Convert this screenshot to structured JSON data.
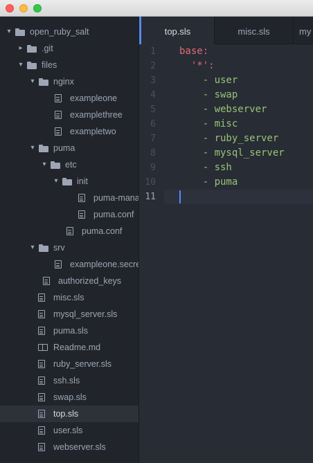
{
  "window": {
    "traffic_lights": [
      "close",
      "minimize",
      "maximize"
    ]
  },
  "sidebar": {
    "items": [
      {
        "label": "open_ruby_salt",
        "type": "folder",
        "expanded": true,
        "depth": 0
      },
      {
        "label": ".git",
        "type": "folder",
        "expanded": false,
        "depth": 1
      },
      {
        "label": "files",
        "type": "folder",
        "expanded": true,
        "depth": 1
      },
      {
        "label": "nginx",
        "type": "folder",
        "expanded": true,
        "depth": 2
      },
      {
        "label": "exampleone",
        "type": "file",
        "depth": 3
      },
      {
        "label": "examplethree",
        "type": "file",
        "depth": 3
      },
      {
        "label": "exampletwo",
        "type": "file",
        "depth": 3
      },
      {
        "label": "puma",
        "type": "folder",
        "expanded": true,
        "depth": 2
      },
      {
        "label": "etc",
        "type": "folder",
        "expanded": true,
        "depth": 3
      },
      {
        "label": "init",
        "type": "folder",
        "expanded": true,
        "depth": 4
      },
      {
        "label": "puma-manag",
        "type": "file",
        "depth": 5
      },
      {
        "label": "puma.conf",
        "type": "file",
        "depth": 5
      },
      {
        "label": "puma.conf",
        "type": "file",
        "depth": 4
      },
      {
        "label": "srv",
        "type": "folder",
        "expanded": true,
        "depth": 2
      },
      {
        "label": "exampleone.secret",
        "type": "file",
        "depth": 3
      },
      {
        "label": "authorized_keys",
        "type": "file",
        "depth": 2
      },
      {
        "label": "misc.sls",
        "type": "file",
        "depth": 1
      },
      {
        "label": "mysql_server.sls",
        "type": "file",
        "depth": 1
      },
      {
        "label": "puma.sls",
        "type": "file",
        "depth": 1
      },
      {
        "label": "Readme.md",
        "type": "book",
        "depth": 1
      },
      {
        "label": "ruby_server.sls",
        "type": "file",
        "depth": 1
      },
      {
        "label": "ssh.sls",
        "type": "file",
        "depth": 1
      },
      {
        "label": "swap.sls",
        "type": "file",
        "depth": 1
      },
      {
        "label": "top.sls",
        "type": "file",
        "depth": 1,
        "selected": true
      },
      {
        "label": "user.sls",
        "type": "file",
        "depth": 1
      },
      {
        "label": "webserver.sls",
        "type": "file",
        "depth": 1
      }
    ]
  },
  "tabs": [
    {
      "label": "top.sls",
      "active": true
    },
    {
      "label": "misc.sls",
      "active": false
    },
    {
      "label": "my",
      "active": false
    }
  ],
  "editor": {
    "line_numbers": [
      "1",
      "2",
      "3",
      "4",
      "5",
      "6",
      "7",
      "8",
      "9",
      "10",
      "11"
    ],
    "current_line": 11,
    "lines": [
      {
        "indent": "",
        "tokens": [
          {
            "text": "base:",
            "cls": "k-red"
          }
        ]
      },
      {
        "indent": "  ",
        "tokens": [
          {
            "text": "'*':",
            "cls": "k-red"
          }
        ]
      },
      {
        "indent": "    ",
        "tokens": [
          {
            "text": "- ",
            "cls": "k-dash"
          },
          {
            "text": "user",
            "cls": "k-green"
          }
        ]
      },
      {
        "indent": "    ",
        "tokens": [
          {
            "text": "- ",
            "cls": "k-dash"
          },
          {
            "text": "swap",
            "cls": "k-green"
          }
        ]
      },
      {
        "indent": "    ",
        "tokens": [
          {
            "text": "- ",
            "cls": "k-dash"
          },
          {
            "text": "webserver",
            "cls": "k-green"
          }
        ]
      },
      {
        "indent": "    ",
        "tokens": [
          {
            "text": "- ",
            "cls": "k-dash"
          },
          {
            "text": "misc",
            "cls": "k-green"
          }
        ]
      },
      {
        "indent": "    ",
        "tokens": [
          {
            "text": "- ",
            "cls": "k-dash"
          },
          {
            "text": "ruby_server",
            "cls": "k-green"
          }
        ]
      },
      {
        "indent": "    ",
        "tokens": [
          {
            "text": "- ",
            "cls": "k-dash"
          },
          {
            "text": "mysql_server",
            "cls": "k-green"
          }
        ]
      },
      {
        "indent": "    ",
        "tokens": [
          {
            "text": "- ",
            "cls": "k-dash"
          },
          {
            "text": "ssh",
            "cls": "k-green"
          }
        ]
      },
      {
        "indent": "    ",
        "tokens": [
          {
            "text": "- ",
            "cls": "k-dash"
          },
          {
            "text": "puma",
            "cls": "k-green"
          }
        ]
      },
      {
        "indent": "",
        "tokens": []
      }
    ]
  },
  "colors": {
    "accent": "#528bff",
    "key": "#e06c75",
    "value": "#98c379"
  }
}
